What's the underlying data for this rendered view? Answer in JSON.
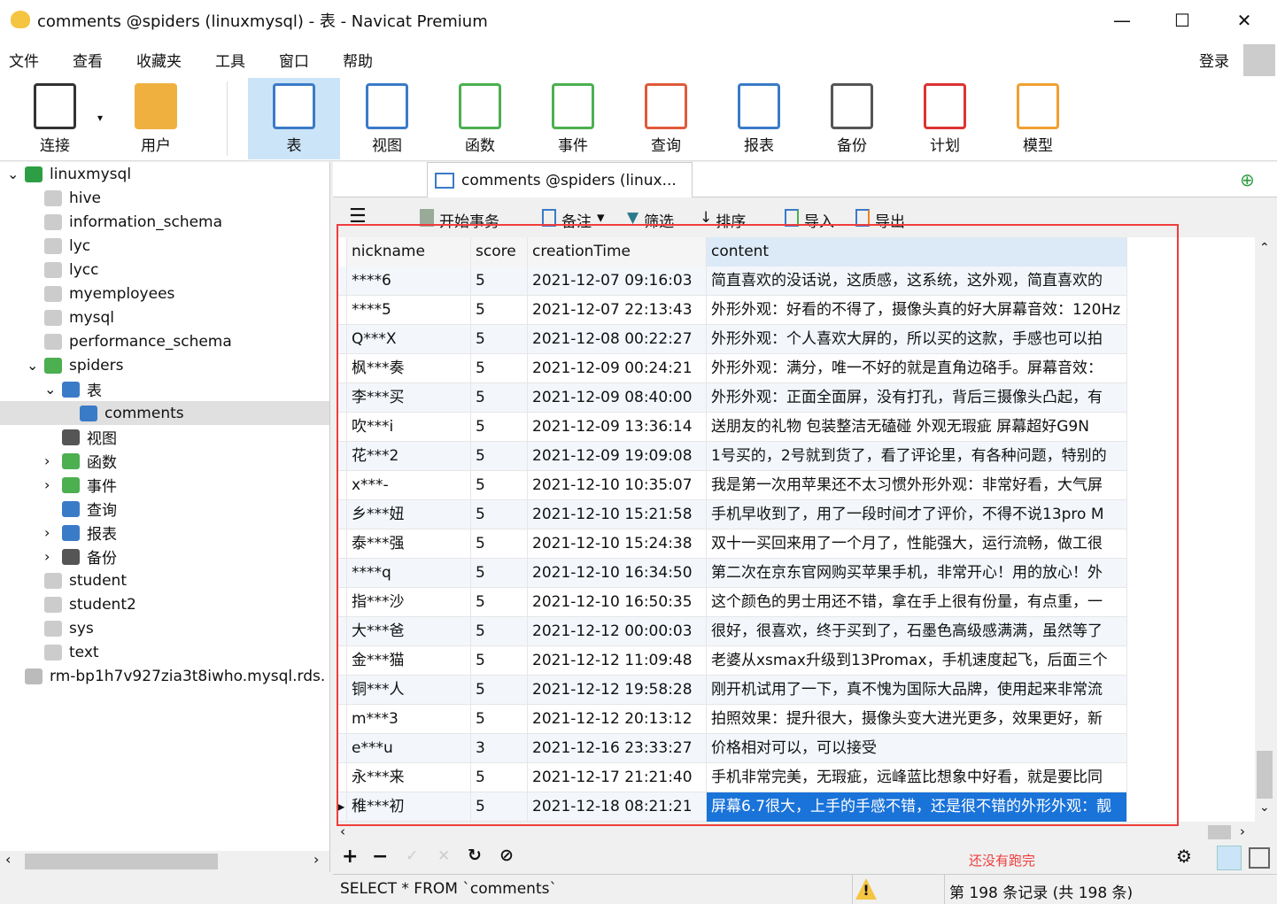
{
  "window": {
    "title": "comments @spiders (linuxmysql) - 表 - Navicat Premium",
    "minimize": "—",
    "maximize": "☐",
    "close": "✕"
  },
  "menu": [
    "文件",
    "查看",
    "收藏夹",
    "工具",
    "窗口",
    "帮助"
  ],
  "login": "登录",
  "toolbar": [
    {
      "label": "连接",
      "icon": "plug-icon",
      "color": "#333"
    },
    {
      "label": "用户",
      "icon": "user-icon",
      "color": "#f0b040"
    },
    {
      "label": "表",
      "icon": "table-icon",
      "color": "#3a7bc8"
    },
    {
      "label": "视图",
      "icon": "view-icon",
      "color": "#3a7bc8"
    },
    {
      "label": "函数",
      "icon": "function-icon",
      "color": "#4caf50"
    },
    {
      "label": "事件",
      "icon": "event-icon",
      "color": "#4caf50"
    },
    {
      "label": "查询",
      "icon": "query-icon",
      "color": "#e05a3a"
    },
    {
      "label": "报表",
      "icon": "report-icon",
      "color": "#3a7bc8"
    },
    {
      "label": "备份",
      "icon": "backup-icon",
      "color": "#555"
    },
    {
      "label": "计划",
      "icon": "schedule-icon",
      "color": "#d33"
    },
    {
      "label": "模型",
      "icon": "model-icon",
      "color": "#f0a030"
    }
  ],
  "tree": [
    {
      "label": "linuxmysql",
      "level": 0,
      "arrow": "⌄",
      "color": "#2e9e44"
    },
    {
      "label": "hive",
      "level": 1,
      "color": "#ccc"
    },
    {
      "label": "information_schema",
      "level": 1,
      "color": "#ccc"
    },
    {
      "label": "lyc",
      "level": 1,
      "color": "#ccc"
    },
    {
      "label": "lycc",
      "level": 1,
      "color": "#ccc"
    },
    {
      "label": "myemployees",
      "level": 1,
      "color": "#ccc"
    },
    {
      "label": "mysql",
      "level": 1,
      "color": "#ccc"
    },
    {
      "label": "performance_schema",
      "level": 1,
      "color": "#ccc"
    },
    {
      "label": "spiders",
      "level": 1,
      "arrow": "⌄",
      "color": "#4caf50"
    },
    {
      "label": "表",
      "level": 2,
      "arrow": "⌄",
      "color": "#3a7bc8"
    },
    {
      "label": "comments",
      "level": 3,
      "color": "#3a7bc8",
      "selected": true
    },
    {
      "label": "视图",
      "level": 2,
      "color": "#555"
    },
    {
      "label": "函数",
      "level": 2,
      "arrow": "›",
      "color": "#4caf50"
    },
    {
      "label": "事件",
      "level": 2,
      "arrow": "›",
      "color": "#4caf50"
    },
    {
      "label": "查询",
      "level": 2,
      "color": "#3a7bc8"
    },
    {
      "label": "报表",
      "level": 2,
      "arrow": "›",
      "color": "#3a7bc8"
    },
    {
      "label": "备份",
      "level": 2,
      "arrow": "›",
      "color": "#555"
    },
    {
      "label": "student",
      "level": 1,
      "color": "#ccc"
    },
    {
      "label": "student2",
      "level": 1,
      "color": "#ccc"
    },
    {
      "label": "sys",
      "level": 1,
      "color": "#ccc"
    },
    {
      "label": "text",
      "level": 1,
      "color": "#ccc"
    },
    {
      "label": "rm-bp1h7v927zia3t8iwho.mysql.rds.",
      "level": 0,
      "color": "#bbb"
    }
  ],
  "tab": {
    "label": "comments @spiders (linux..."
  },
  "gridtoolbar": {
    "menu": "☰",
    "begin": "开始事务",
    "note": "备注",
    "filter": "筛选",
    "sort": "排序",
    "import": "导入",
    "export": "导出"
  },
  "columns": [
    "nickname",
    "score",
    "creationTime",
    "content"
  ],
  "rows": [
    [
      "****6",
      "5",
      "2021-12-07 09:16:03",
      "简直喜欢的没话说，这质感，这系统，这外观，简直喜欢的"
    ],
    [
      "****5",
      "5",
      "2021-12-07 22:13:43",
      "外形外观：好看的不得了，摄像头真的好大屏幕音效：120Hz"
    ],
    [
      "Q***X",
      "5",
      "2021-12-08 00:22:27",
      "外形外观：个人喜欢大屏的，所以买的这款，手感也可以拍"
    ],
    [
      "枫***奏",
      "5",
      "2021-12-09 00:24:21",
      "外形外观：满分，唯一不好的就是直角边硌手。屏幕音效："
    ],
    [
      "李***买",
      "5",
      "2021-12-09 08:40:00",
      "外形外观：正面全面屏，没有打孔，背后三摄像头凸起，有"
    ],
    [
      "吹***i",
      "5",
      "2021-12-09 13:36:14",
      "送朋友的礼物 包装整洁无磕碰  外观无瑕疵 屏幕超好G9N"
    ],
    [
      "花***2",
      "5",
      "2021-12-09 19:09:08",
      "1号买的，2号就到货了，看了评论里，有各种问题，特别的"
    ],
    [
      "x***-",
      "5",
      "2021-12-10 10:35:07",
      "我是第一次用苹果还不太习惯外形外观：非常好看，大气屏"
    ],
    [
      "乡***妞",
      "5",
      "2021-12-10 15:21:58",
      "手机早收到了，用了一段时间才了评价，不得不说13pro M"
    ],
    [
      "泰***强",
      "5",
      "2021-12-10 15:24:38",
      "双十一买回来用了一个月了，性能强大，运行流畅，做工很"
    ],
    [
      "****q",
      "5",
      "2021-12-10 16:34:50",
      "第二次在京东官网购买苹果手机，非常开心！用的放心！外"
    ],
    [
      "指***沙",
      "5",
      "2021-12-10 16:50:35",
      "这个颜色的男士用还不错，拿在手上很有份量，有点重，一"
    ],
    [
      "大***爸",
      "5",
      "2021-12-12 00:00:03",
      "很好，很喜欢，终于买到了，石墨色高级感满满，虽然等了"
    ],
    [
      "金***猫",
      "5",
      "2021-12-12 11:09:48",
      "老婆从xsmax升级到13Promax，手机速度起飞，后面三个"
    ],
    [
      "铜***人",
      "5",
      "2021-12-12 19:58:28",
      "刚开机试用了一下，真不愧为国际大品牌，使用起来非常流"
    ],
    [
      "m***3",
      "5",
      "2021-12-12 20:13:12",
      "拍照效果：提升很大，摄像头变大进光更多，效果更好，新"
    ],
    [
      "e***u",
      "3",
      "2021-12-16 23:33:27",
      "价格相对可以，可以接受"
    ],
    [
      "永***来",
      "5",
      "2021-12-17 21:21:40",
      "手机非常完美，无瑕疵，远峰蓝比想象中好看，就是要比同"
    ],
    [
      "稚***初",
      "5",
      "2021-12-18 08:21:21",
      "屏幕6.7很大，上手的手感不错，还是很不错的外形外观：靓"
    ]
  ],
  "selected_row": 18,
  "bottom": {
    "add": "+",
    "remove": "−",
    "apply": "✓",
    "discard": "✕",
    "refresh": "↻",
    "stop": "⊘",
    "annotation": "还没有跑完",
    "settings": "⚙"
  },
  "status": {
    "sql": "SELECT * FROM `comments`",
    "warning": "!",
    "records": "第 198 条记录 (共 198 条)"
  }
}
